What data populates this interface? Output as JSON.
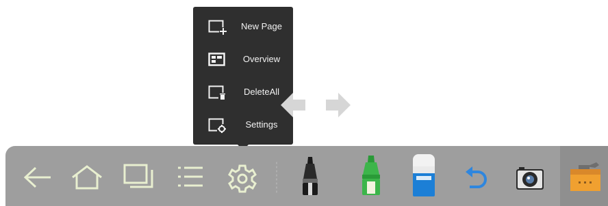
{
  "menu": {
    "items": [
      {
        "label": "New Page",
        "icon": "new-page-icon"
      },
      {
        "label": "Overview",
        "icon": "overview-icon"
      },
      {
        "label": "DeleteAll",
        "icon": "delete-all-icon"
      },
      {
        "label": "Settings",
        "icon": "settings-page-icon"
      }
    ]
  },
  "nav": {
    "prev_icon": "arrow-left-icon",
    "next_icon": "arrow-right-icon"
  },
  "toolbar": {
    "tools": [
      "back-icon",
      "home-icon",
      "windows-icon",
      "menu-icon",
      "gear-icon",
      "black-marker-icon",
      "green-highlighter-icon",
      "eraser-icon",
      "undo-icon",
      "camera-icon",
      "toolbox-icon"
    ],
    "colors": {
      "bar": "#9e9e9e",
      "menu_bg": "#2f2f2f",
      "icon_light": "#e8efd0",
      "undo_blue": "#2e86de",
      "highlighter_green": "#3cb54a",
      "toolbox_orange": "#f0a030"
    }
  }
}
